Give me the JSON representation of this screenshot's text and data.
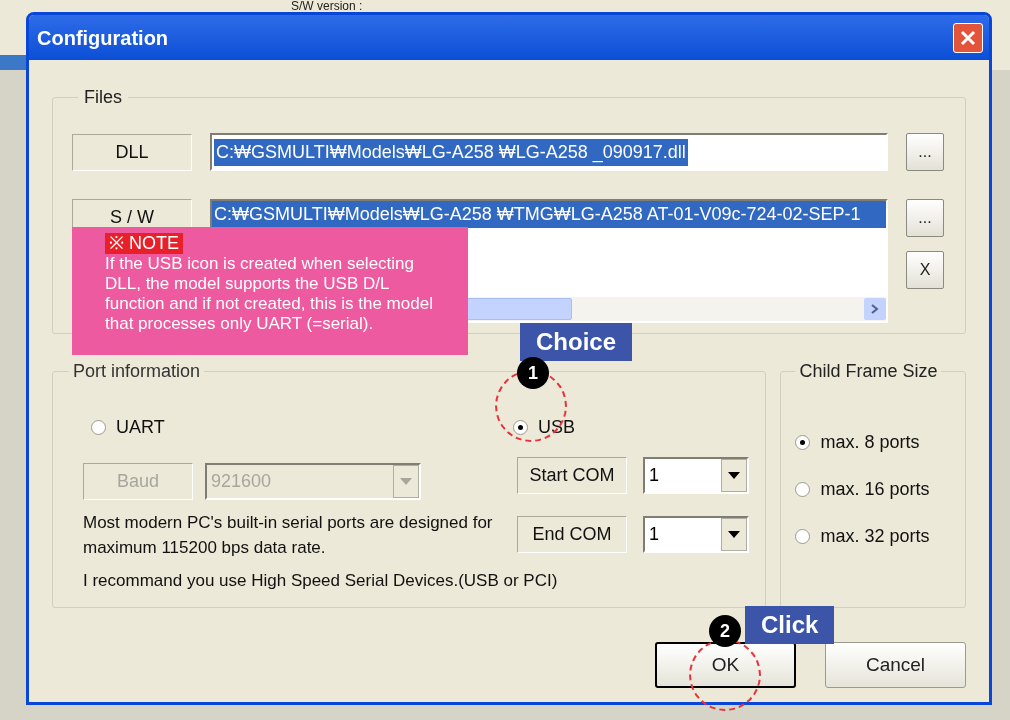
{
  "background_window": {
    "label": "S/W version :"
  },
  "window": {
    "title": "Configuration"
  },
  "files": {
    "title": "Files",
    "dll": {
      "label": "DLL",
      "value": "C:₩GSMULTI₩Models₩LG-A258 ₩LG-A258 _090917.dll",
      "selected": true,
      "browse": "..."
    },
    "sw": {
      "label": "S / W",
      "items": [
        {
          "text": "C:₩GSMULTI₩Models₩LG-A258 ₩TMG₩LG-A258 AT-01-V09c-724-02-SEP-1",
          "selected": true
        }
      ],
      "browse": "...",
      "clear": "X"
    }
  },
  "port_information": {
    "title": "Port information",
    "modes": [
      {
        "label": "UART",
        "selected": false
      },
      {
        "label": "USB",
        "selected": true
      }
    ],
    "baud": {
      "label": "Baud",
      "value": "921600",
      "disabled": true
    },
    "info": [
      "Most modern PC's built-in serial ports are designed for maximum 115200 bps data rate.",
      "I recommand you use High Speed Serial Devices.(USB or PCI)"
    ],
    "start_com": {
      "label": "Start COM",
      "value": "1"
    },
    "end_com": {
      "label": "End COM",
      "value": "1"
    }
  },
  "child_frame_size": {
    "title": "Child Frame Size",
    "options": [
      {
        "label": "max. 8 ports",
        "selected": true
      },
      {
        "label": "max. 16 ports",
        "selected": false
      },
      {
        "label": "max. 32 ports",
        "selected": false
      }
    ]
  },
  "buttons": [
    {
      "label": "OK",
      "default": true
    },
    {
      "label": "Cancel",
      "default": false
    }
  ],
  "annotations": {
    "note": {
      "tag": "※ NOTE",
      "text": "If the USB icon is created when selecting DLL, the model supports the USB D/L function and if not created, this is the model that processes only UART (=serial)."
    },
    "steps": [
      {
        "number": "1",
        "label": "Choice"
      },
      {
        "number": "2",
        "label": "Click"
      }
    ]
  }
}
